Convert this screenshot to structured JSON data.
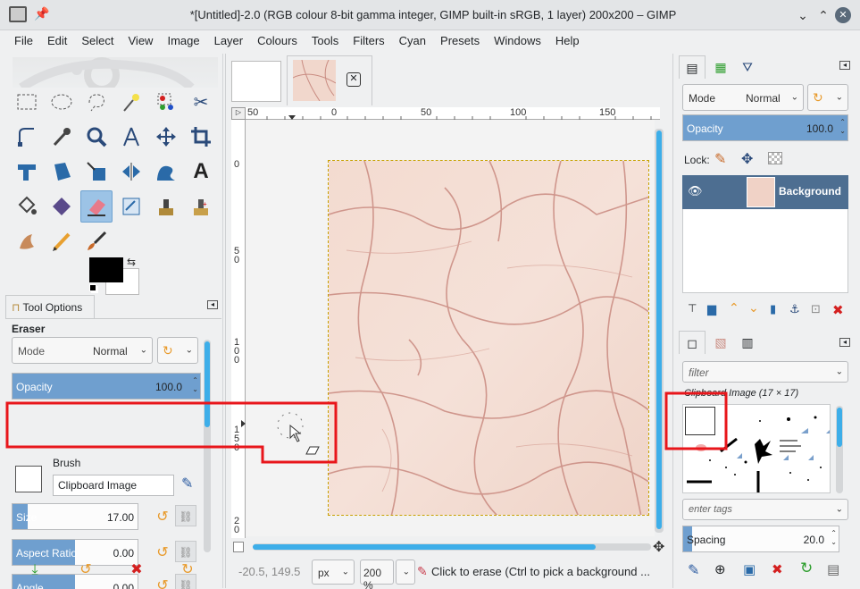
{
  "window": {
    "title": "*[Untitled]-2.0 (RGB colour 8-bit gamma integer, GIMP built-in sRGB, 1 layer) 200x200 – GIMP"
  },
  "menu": [
    "File",
    "Edit",
    "Select",
    "View",
    "Image",
    "Layer",
    "Colours",
    "Tools",
    "Filters",
    "Cyan",
    "Presets",
    "Windows",
    "Help"
  ],
  "toolbox": {
    "tools": [
      "rect-select-icon",
      "ellipse-select-icon",
      "free-select-icon",
      "fuzzy-select-icon",
      "color-select-icon",
      "scissors-icon",
      "paths-icon",
      "color-picker-icon",
      "zoom-icon",
      "measure-icon",
      "move-icon",
      "crop-icon",
      "transform-icon",
      "perspective-icon",
      "scale-icon",
      "flip-icon",
      "warp-icon",
      "text-icon",
      "bucket-fill-icon",
      "gradient-icon",
      "eraser-icon",
      "airbrush-icon",
      "clone-icon",
      "heal-icon",
      "smudge-icon",
      "pencil-icon",
      "paintbrush-icon"
    ],
    "active_tool": "eraser-icon"
  },
  "tool_options": {
    "tab_label": "Tool Options",
    "heading": "Eraser",
    "mode_label": "Mode",
    "mode_value": "Normal",
    "opacity": {
      "label": "Opacity",
      "value": "100.0",
      "fraction": 1.0
    },
    "brush_label": "Brush",
    "brush_value": "Clipboard Image",
    "size": {
      "label": "Size",
      "value": "17.00",
      "fraction": 0.12
    },
    "aspect_ratio": {
      "label": "Aspect Ratio",
      "value": "0.00",
      "fraction": 0.5
    },
    "angle": {
      "label": "Angle",
      "value": "0.00",
      "fraction": 0.5
    }
  },
  "canvas": {
    "ruler_h": [
      "50",
      "0",
      "50",
      "100",
      "150"
    ],
    "ruler_v": [
      "0",
      "5\n0",
      "1\n0\n0",
      "1\n5\n0",
      "2\n0"
    ],
    "coords": "-20.5, 149.5",
    "unit": "px",
    "zoom": "200 %",
    "status": "Click to erase (Ctrl to pick a background ..."
  },
  "layers": {
    "mode_label": "Mode",
    "mode_value": "Normal",
    "opacity": {
      "label": "Opacity",
      "value": "100.0",
      "fraction": 1.0
    },
    "lock_label": "Lock:",
    "layer_name": "Background"
  },
  "brushes": {
    "filter_placeholder": "filter",
    "title": "Clipboard Image (17 × 17)",
    "tags_placeholder": "enter tags",
    "spacing": {
      "label": "Spacing",
      "value": "20.0",
      "fraction": 0.06
    }
  },
  "colors": {
    "accent": "#3daee9",
    "slider_fill": "#6f9fcf",
    "highlight_box": "#e8161b",
    "marble_base": "#f1d7cc",
    "layer_selected": "#4d6e91"
  }
}
